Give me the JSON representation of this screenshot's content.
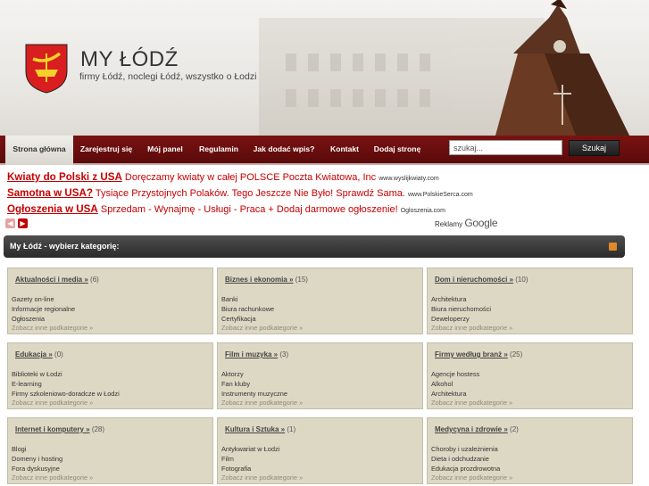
{
  "header": {
    "title": "MY ŁÓDŹ",
    "subtitle": "firmy Łódź, noclegi Łódź, wszystko o Łodzi"
  },
  "nav": {
    "items": [
      {
        "label": "Strona główna",
        "active": true
      },
      {
        "label": "Zarejestruj się"
      },
      {
        "label": "Mój panel"
      },
      {
        "label": "Regulamin"
      },
      {
        "label": "Jak dodać wpis?"
      },
      {
        "label": "Kontakt"
      },
      {
        "label": "Dodaj stronę"
      }
    ],
    "search_placeholder": "szukaj...",
    "search_button": "Szukaj"
  },
  "ads": [
    {
      "title": "Kwiaty do Polski z USA",
      "text": "Doręczamy kwiaty w całej POLSCE Poczta Kwiatowa, Inc",
      "url": "www.wyslijkwiaty.com"
    },
    {
      "title": "Samotna w USA?",
      "text": "Tysiące Przystojnych Polaków. Tego Jeszcze Nie Było! Sprawdź Sama.",
      "url": "www.PolskieSerca.com"
    },
    {
      "title": "Ogłoszenia w USA",
      "text": "Sprzedam - Wynajmę - Usługi - Praca + Dodaj darmowe ogłoszenie!",
      "url": "Ogloszenia.com"
    }
  ],
  "ads_by": {
    "label": "Reklamy",
    "brand": "Google"
  },
  "categories_title": "My Łódź - wybierz kategorię:",
  "more_label": "Zobacz inne podkategorie »",
  "categories": [
    {
      "name": "Aktualności i media »",
      "count": "(6)",
      "subs": [
        "Gazety on-line",
        "Informacje regionalne",
        "Ogłoszenia"
      ]
    },
    {
      "name": "Biznes i ekonomia »",
      "count": "(15)",
      "subs": [
        "Banki",
        "Biura rachunkowe",
        "Certyfikacja"
      ]
    },
    {
      "name": "Dom i nieruchomości »",
      "count": "(10)",
      "subs": [
        "Architektura",
        "Biura nieruchomości",
        "Deweloperzy"
      ]
    },
    {
      "name": "Edukacja »",
      "count": "(0)",
      "subs": [
        "Biblioteki w Łodzi",
        "E-learning",
        "Firmy szkoleniowo-doradcze w Łodzi"
      ]
    },
    {
      "name": "Film i muzyka »",
      "count": "(3)",
      "subs": [
        "Aktorzy",
        "Fan kluby",
        "Instrumenty muzyczne"
      ]
    },
    {
      "name": "Firmy według branż »",
      "count": "(25)",
      "subs": [
        "Agencje hostess",
        "Alkohol",
        "Architektura"
      ]
    },
    {
      "name": "Internet i komputery »",
      "count": "(28)",
      "subs": [
        "Blogi",
        "Domeny i hosting",
        "Fora dyskusyjne"
      ]
    },
    {
      "name": "Kultura i Sztuka »",
      "count": "(1)",
      "subs": [
        "Antykwariat w Łodzi",
        "Film",
        "Fotografia"
      ]
    },
    {
      "name": "Medycyna i zdrowie »",
      "count": "(2)",
      "subs": [
        "Choroby i uzależnienia",
        "Dieta i odchudzanie",
        "Edukacja prozdrowotna"
      ]
    }
  ]
}
